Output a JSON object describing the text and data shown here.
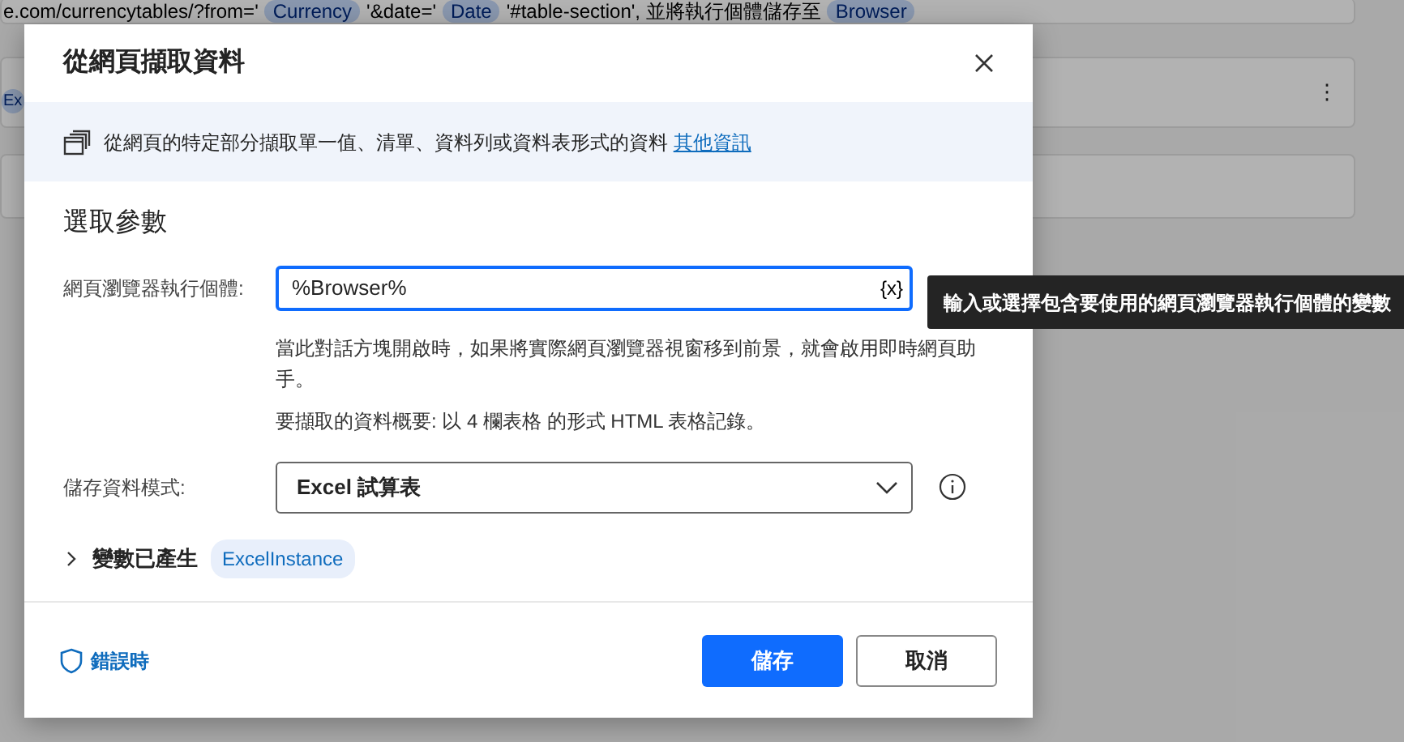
{
  "background": {
    "command_parts": [
      {
        "kind": "text",
        "text": "e.com/currencytables/?from='"
      },
      {
        "kind": "token",
        "text": "Currency"
      },
      {
        "kind": "text",
        "text": "'&date='"
      },
      {
        "kind": "token",
        "text": "Date"
      },
      {
        "kind": "text",
        "text": "'#table-section', 並將執行個體儲存至"
      },
      {
        "kind": "token",
        "text": "Browser"
      }
    ],
    "row_token": "Ex",
    "row_menu": "⋮"
  },
  "dialog": {
    "title": "從網頁擷取資料",
    "info": {
      "text": "從網頁的特定部分擷取單一值、清單、資料列或資料表形式的資料",
      "link": "其他資訊"
    },
    "section_title": "選取參數",
    "browser_field": {
      "label": "網頁瀏覽器執行個體:",
      "value": "%Browser%",
      "variable_button": "{x}",
      "focused": true
    },
    "tooltip": "輸入或選擇包含要使用的網頁瀏覽器執行個體的變數",
    "help_text": "當此對話方塊開啟時，如果將實際網頁瀏覽器視窗移到前景，就會啟用即時網頁助手。",
    "summary": "要擷取的資料概要: 以 4 欄表格 的形式 HTML 表格記錄。",
    "save_mode": {
      "label": "儲存資料模式:",
      "value": "Excel 試算表"
    },
    "variables": {
      "label": "變數已產生",
      "expanded": false,
      "chips": [
        "ExcelInstance"
      ]
    },
    "footer": {
      "error_link": "錯誤時",
      "buttons": [
        {
          "kind": "primary",
          "label": "儲存"
        },
        {
          "kind": "secondary",
          "label": "取消"
        }
      ]
    }
  }
}
